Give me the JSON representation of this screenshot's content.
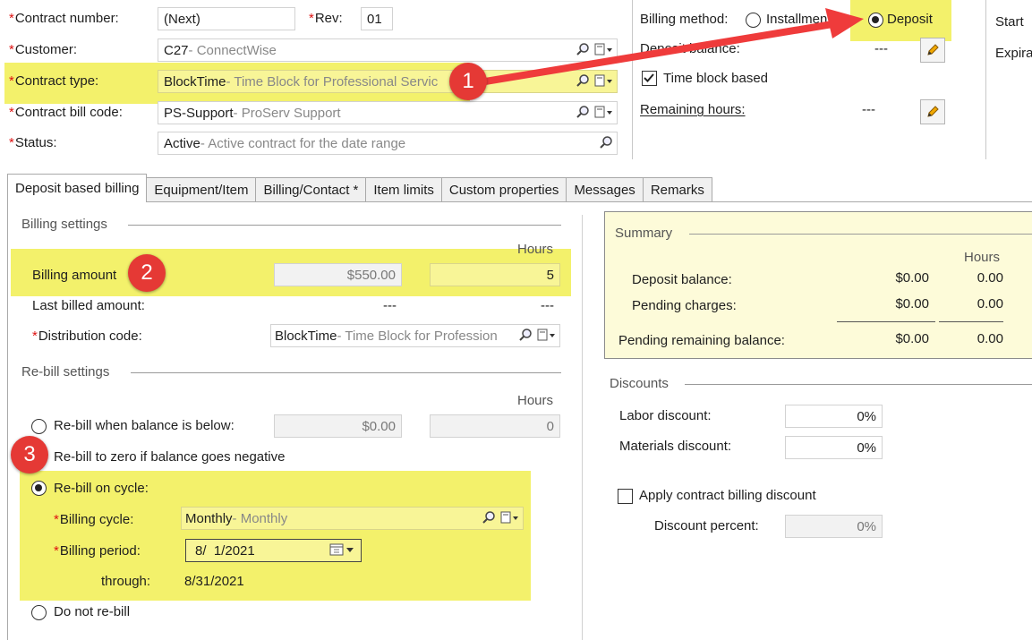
{
  "header": {
    "contract_number": {
      "label": "Contract number:",
      "value": "(Next)"
    },
    "rev": {
      "label": "Rev:",
      "value": "01"
    },
    "customer": {
      "label": "Customer:",
      "code": "C27",
      "desc": " - ConnectWise"
    },
    "contract_type": {
      "label": "Contract type:",
      "code": "BlockTime",
      "desc": " - Time Block for Professional Servic"
    },
    "contract_bill_code": {
      "label": "Contract bill code:",
      "code": "PS-Support",
      "desc": " - ProServ Support"
    },
    "status": {
      "label": "Status:",
      "code": "Active",
      "desc": " - Active contract for the date range"
    },
    "billing_method": {
      "label": "Billing method:",
      "option_installment": "Installmen",
      "option_deposit": "Deposit",
      "selected": "Deposit"
    },
    "deposit_balance": {
      "label": "Deposit balance:",
      "value": "---"
    },
    "time_block_based": {
      "label": "Time block based",
      "checked": true
    },
    "remaining_hours": {
      "label": "Remaining hours:",
      "value": "---"
    },
    "start_label": "Start",
    "expiration_label": "Expira"
  },
  "tabs": [
    {
      "label": "Deposit based billing",
      "active": true
    },
    {
      "label": "Equipment/Item"
    },
    {
      "label": "Billing/Contact *"
    },
    {
      "label": "Item limits"
    },
    {
      "label": "Custom properties"
    },
    {
      "label": "Messages"
    },
    {
      "label": "Remarks"
    }
  ],
  "billing_settings": {
    "title": "Billing settings",
    "hours_header": "Hours",
    "billing_amount": {
      "label": "Billing amount",
      "amount": "$550.00",
      "hours": "5"
    },
    "last_billed_amount": {
      "label": "Last billed amount:",
      "amount": "---",
      "hours": "---"
    },
    "distribution_code": {
      "label": "Distribution code:",
      "code": "BlockTime",
      "desc": " - Time Block for Profession"
    }
  },
  "rebill_settings": {
    "title": "Re-bill settings",
    "hours_header": "Hours",
    "rebill_below": {
      "label": "Re-bill when balance is below:",
      "amount": "$0.00",
      "hours": "0"
    },
    "rebill_zero": {
      "label": "Re-bill to zero if balance goes negative"
    },
    "rebill_cycle": {
      "label": "Re-bill on cycle:",
      "selected": true
    },
    "billing_cycle": {
      "label": "Billing cycle:",
      "code": "Monthly",
      "desc": " - Monthly"
    },
    "billing_period": {
      "label": "Billing period:",
      "value": "8/  1/2021"
    },
    "through": {
      "label": "through:",
      "value": "8/31/2021"
    },
    "do_not_rebill": {
      "label": "Do not re-bill"
    }
  },
  "summary": {
    "title": "Summary",
    "hours_header": "Hours",
    "rows": [
      {
        "label": "Deposit balance:",
        "amount": "$0.00",
        "hours": "0.00"
      },
      {
        "label": "Pending charges:",
        "amount": "$0.00",
        "hours": "0.00"
      }
    ],
    "total": {
      "label": "Pending remaining balance:",
      "amount": "$0.00",
      "hours": "0.00"
    }
  },
  "discounts": {
    "title": "Discounts",
    "labor": {
      "label": "Labor discount:",
      "value": "0%"
    },
    "materials": {
      "label": "Materials discount:",
      "value": "0%"
    },
    "apply": {
      "label": "Apply contract billing discount",
      "checked": false
    },
    "percent": {
      "label": "Discount percent:",
      "value": "0%"
    }
  },
  "callouts": [
    "1",
    "2",
    "3"
  ],
  "colors": {
    "highlight": "#f3f16b",
    "callout": "#e53935",
    "arrow": "#ef3b3b",
    "required": "#dd1111"
  }
}
